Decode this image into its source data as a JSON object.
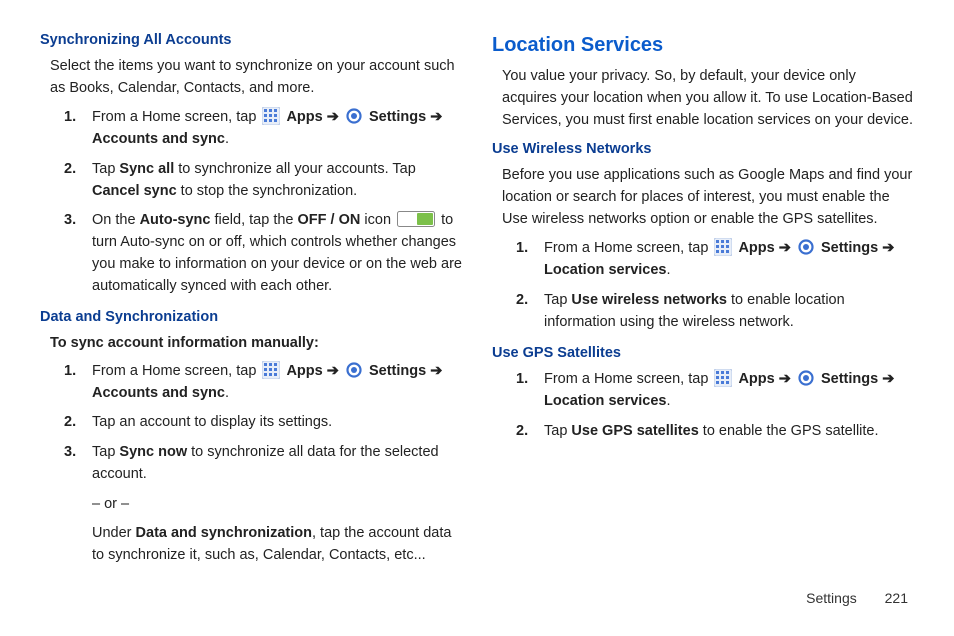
{
  "footer": {
    "section": "Settings",
    "page": "221"
  },
  "nav": {
    "apps": "Apps",
    "settings": "Settings",
    "arrow": "➔"
  },
  "left": {
    "sync_all_heading": "Synchronizing All Accounts",
    "sync_all_para": "Select the items you want to synchronize on your account such as Books, Calendar, Contacts, and more.",
    "step1_a": "From a Home screen, tap ",
    "step1_dest": "Accounts and sync",
    "step2_a": "Tap ",
    "step2_b": "Sync all",
    "step2_c": " to synchronize all your accounts. Tap ",
    "step2_d": "Cancel sync",
    "step2_e": " to stop the synchronization.",
    "step3_a": "On the ",
    "step3_b": "Auto-sync",
    "step3_c": " field, tap the ",
    "step3_d": "OFF / ON",
    "step3_e": " icon ",
    "step3_f": " to turn Auto-sync on or off, which controls whether changes you make to information on your device or on the web are automatically synced with each other.",
    "data_sync_heading": "Data and Synchronization",
    "data_sync_intro": "To sync account information manually:",
    "ds_step1_a": "From a Home screen, tap ",
    "ds_step1_dest": "Accounts and sync",
    "ds_step2": "Tap an account to display its settings.",
    "ds_step3_a": "Tap ",
    "ds_step3_b": "Sync now",
    "ds_step3_c": " to synchronize all data for the selected account.",
    "ds_or": "– or –",
    "ds_step3_d": "Under ",
    "ds_step3_e": "Data and synchronization",
    "ds_step3_f": ", tap the account data to synchronize it, such as, Calendar, Contacts, etc..."
  },
  "right": {
    "loc_heading": "Location Services",
    "loc_para": "You value your privacy. So, by default, your device only acquires your location when you allow it. To use Location-Based Services, you must first enable location services on your device.",
    "wn_heading": "Use Wireless Networks",
    "wn_para": "Before you use applications such as Google Maps and find your location or search for places of interest, you must enable the Use wireless networks option or enable the GPS satellites.",
    "wn_step1_a": "From a Home screen, tap ",
    "wn_step1_dest": "Location services",
    "wn_step2_a": "Tap ",
    "wn_step2_b": "Use wireless networks",
    "wn_step2_c": " to enable location information using the wireless network.",
    "gps_heading": "Use GPS Satellites",
    "gps_step1_a": "From a Home screen, tap ",
    "gps_step1_dest": "Location services",
    "gps_step2_a": "Tap ",
    "gps_step2_b": "Use GPS satellites",
    "gps_step2_c": " to enable the GPS satellite."
  }
}
